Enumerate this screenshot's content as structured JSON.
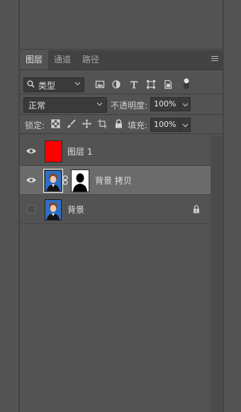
{
  "panel": {
    "tabs": [
      {
        "label": "图层",
        "active": true
      },
      {
        "label": "通道",
        "active": false
      },
      {
        "label": "路径",
        "active": false
      }
    ]
  },
  "filter": {
    "selected": "类型",
    "icons": [
      "pixel-filter-icon",
      "adjustment-filter-icon",
      "type-filter-icon",
      "shape-filter-icon",
      "smartobject-filter-icon",
      "filter-toggle-icon"
    ]
  },
  "blend": {
    "mode": "正常",
    "opacity_label": "不透明度:",
    "opacity_value": "100%"
  },
  "lock": {
    "label": "锁定:",
    "fill_label": "填充:",
    "fill_value": "100%",
    "icons": [
      "lock-transparent-icon",
      "lock-image-icon",
      "lock-position-icon",
      "lock-artboard-icon",
      "lock-all-icon"
    ]
  },
  "layers": [
    {
      "name": "图层 1",
      "visible": true,
      "selected": false,
      "thumb": "red-fill",
      "mask": false,
      "locked": false
    },
    {
      "name": "背景 拷贝",
      "visible": true,
      "selected": true,
      "thumb": "portrait",
      "mask": true,
      "locked": false
    },
    {
      "name": "背景",
      "visible": false,
      "selected": false,
      "thumb": "portrait",
      "mask": false,
      "locked": true
    }
  ],
  "colors": {
    "background": "#535353",
    "tab_bar": "#424242",
    "selected_layer": "#6b6b6b",
    "fill_swatch": "#ff0000",
    "photo_background": "#2d6fc6"
  }
}
